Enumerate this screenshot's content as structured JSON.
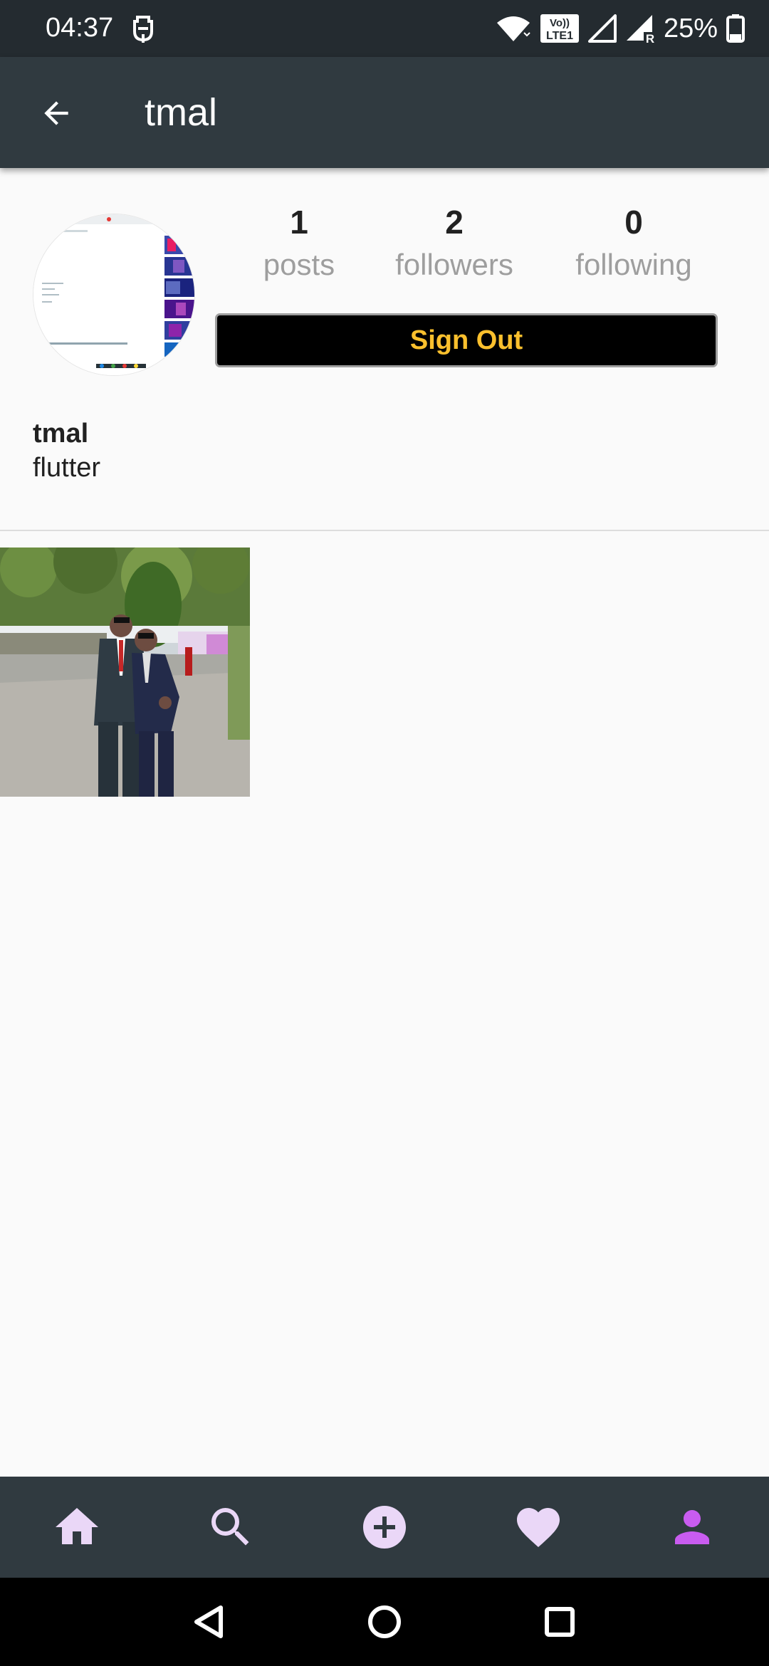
{
  "status_bar": {
    "time": "04:37",
    "network_badge_line1": "Vo))",
    "network_badge_line2": "LTE1",
    "roaming_indicator": "R",
    "battery": "25%",
    "icons": [
      "notification-icon",
      "wifi-icon",
      "volte-icon",
      "signal-icon",
      "signal-roaming-icon",
      "battery-icon"
    ]
  },
  "app_bar": {
    "title": "tmal",
    "back_icon": "arrow-back-icon"
  },
  "profile": {
    "stats": [
      {
        "value": "1",
        "label": "posts"
      },
      {
        "value": "2",
        "label": "followers"
      },
      {
        "value": "0",
        "label": "following"
      }
    ],
    "sign_out_label": "Sign Out",
    "username": "tmal",
    "bio": "flutter"
  },
  "posts_grid": {
    "count_shown": 1
  },
  "bottom_nav": {
    "items": [
      "home-icon",
      "search-icon",
      "add-circle-icon",
      "favorite-icon",
      "person-icon"
    ],
    "selected": "person-icon"
  },
  "system_nav": {
    "items": [
      "back-triangle-icon",
      "home-circle-icon",
      "recents-square-icon"
    ]
  },
  "colors": {
    "status_bar": "#242b30",
    "app_bar": "#303a40",
    "background": "#fafafa",
    "sign_out_bg": "#000000",
    "sign_out_text": "#fbc02d",
    "nav_icon": "#ead7f7",
    "nav_icon_selected": "#c95cf0",
    "stat_label": "#9e9e9e"
  }
}
